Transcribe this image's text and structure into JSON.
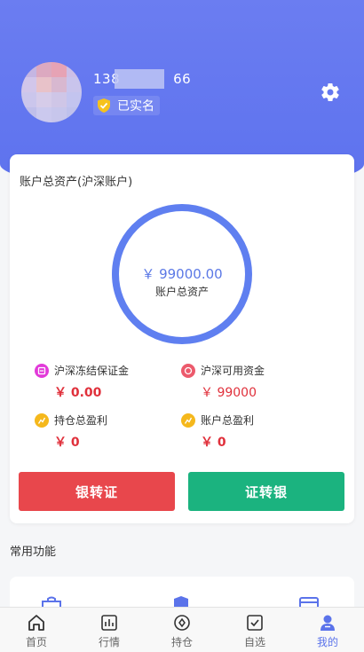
{
  "header": {
    "phone_prefix": "138",
    "phone_suffix": "66",
    "verified_label": "已实名"
  },
  "assets_card": {
    "title": "账户总资产(沪深账户)",
    "total_amount": "￥ 99000.00",
    "total_label": "账户总资产",
    "stats": [
      {
        "label": "沪深冻结保证金",
        "value": "￥ 0.00",
        "icon": "frozen-icon",
        "color": "#e23ad9"
      },
      {
        "label": "沪深可用资金",
        "value": "￥ 99000",
        "icon": "wallet-icon",
        "color": "#ec5a6c"
      },
      {
        "label": "持仓总盈利",
        "value": "￥ 0",
        "icon": "profit-icon",
        "color": "#f5b81c"
      },
      {
        "label": "账户总盈利",
        "value": "￥ 0",
        "icon": "profit-icon",
        "color": "#f5b81c"
      }
    ],
    "bank_to_securities": "银转证",
    "securities_to_bank": "证转银"
  },
  "common_functions": {
    "title": "常用功能"
  },
  "tabbar": [
    {
      "label": "首页",
      "icon": "home-icon"
    },
    {
      "label": "行情",
      "icon": "chart-icon"
    },
    {
      "label": "持仓",
      "icon": "position-icon"
    },
    {
      "label": "自选",
      "icon": "checkbox-icon"
    },
    {
      "label": "我的",
      "icon": "user-icon",
      "active": true
    }
  ],
  "colors": {
    "header": "#6b7df1",
    "ring": "#5f7ff0",
    "red_button": "#e8474c",
    "green_button": "#1bb37f",
    "active_tab": "#5b73ea"
  }
}
